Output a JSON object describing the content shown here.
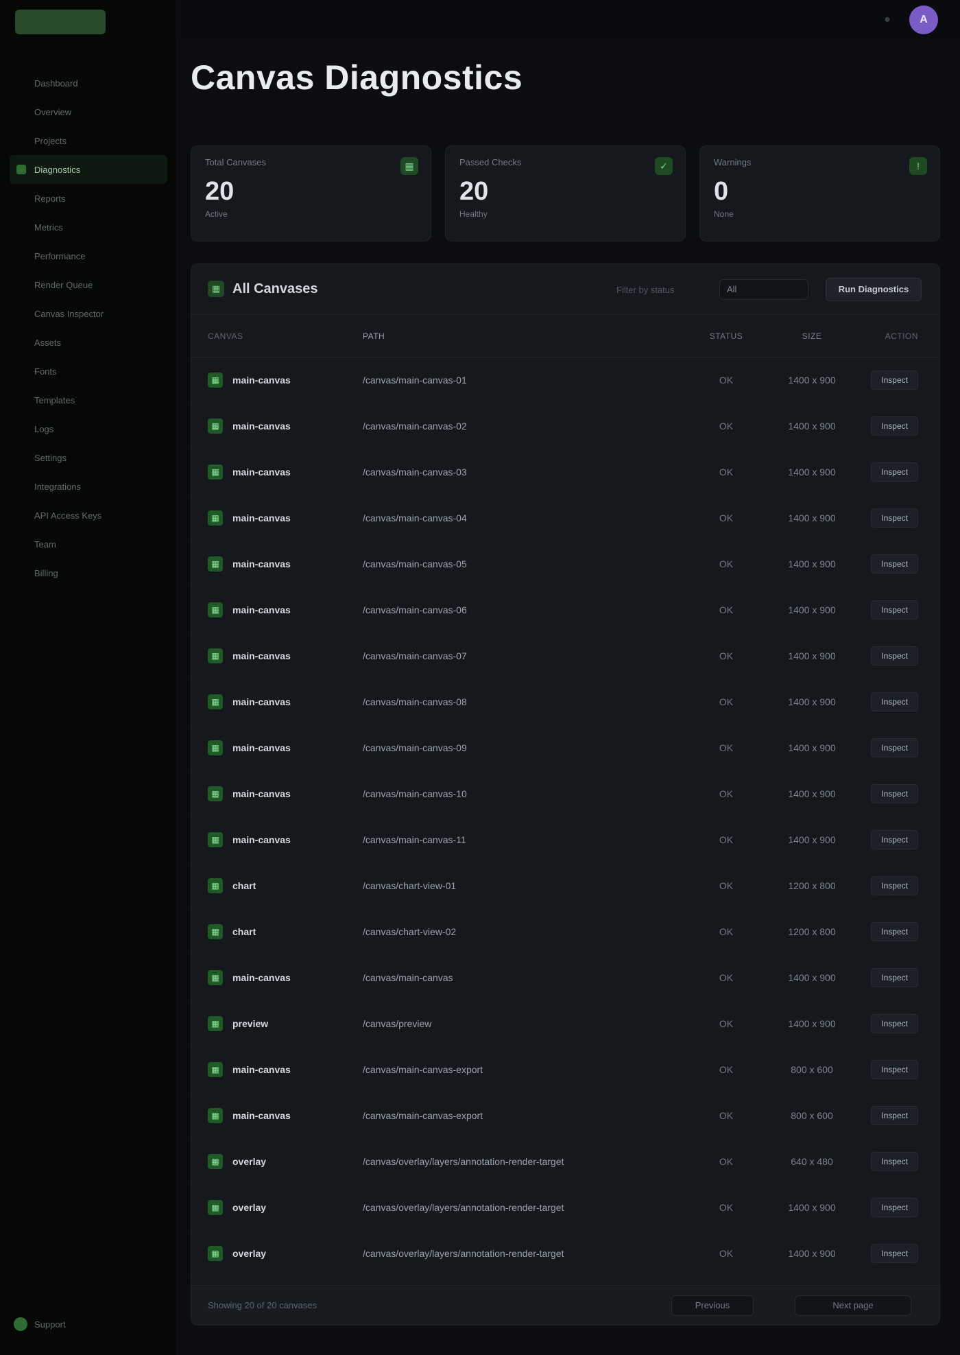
{
  "app": {
    "logo_icon": "app-logo",
    "top_icon": "bell-icon",
    "avatar_initial": "A",
    "avatar_color": "#7b5cc7",
    "accent_color": "#2f6b35"
  },
  "page": {
    "title": "Canvas Diagnostics"
  },
  "sidebar": {
    "items": [
      {
        "label": "Dashboard",
        "active": false
      },
      {
        "label": "Overview",
        "active": false
      },
      {
        "label": "Projects",
        "active": false
      },
      {
        "label": "Diagnostics",
        "active": true
      },
      {
        "label": "Reports",
        "active": false
      },
      {
        "label": "Metrics",
        "active": false
      },
      {
        "label": "Performance",
        "active": false
      },
      {
        "label": "Render Queue",
        "active": false
      },
      {
        "label": "Canvas Inspector",
        "active": false
      },
      {
        "label": "Assets",
        "active": false
      },
      {
        "label": "Fonts",
        "active": false
      },
      {
        "label": "Templates",
        "active": false
      },
      {
        "label": "Logs",
        "active": false
      },
      {
        "label": "Settings",
        "active": false
      },
      {
        "label": "Integrations",
        "active": false
      },
      {
        "label": "API Access Keys",
        "active": false
      },
      {
        "label": "Team",
        "active": false
      },
      {
        "label": "Billing",
        "active": false
      }
    ],
    "footer_label": "Support"
  },
  "stats": [
    {
      "label": "Total Canvases",
      "value": "20",
      "sub": "Active",
      "icon": "grid-icon"
    },
    {
      "label": "Passed Checks",
      "value": "20",
      "sub": "Healthy",
      "icon": "check-icon"
    },
    {
      "label": "Warnings",
      "value": "0",
      "sub": "None",
      "icon": "alert-icon"
    }
  ],
  "table": {
    "title": "All Canvases",
    "title_icon": "grid-icon",
    "filter_label": "Filter by status",
    "filter_value": "All",
    "action_label": "Run Diagnostics",
    "columns": [
      "Canvas",
      "Path",
      "Status",
      "Size",
      "Action"
    ],
    "rows": [
      {
        "name": "main-canvas",
        "path": "/canvas/main-canvas-01",
        "status": "OK",
        "size": "1400 x 900",
        "action": "Inspect"
      },
      {
        "name": "main-canvas",
        "path": "/canvas/main-canvas-02",
        "status": "OK",
        "size": "1400 x 900",
        "action": "Inspect"
      },
      {
        "name": "main-canvas",
        "path": "/canvas/main-canvas-03",
        "status": "OK",
        "size": "1400 x 900",
        "action": "Inspect"
      },
      {
        "name": "main-canvas",
        "path": "/canvas/main-canvas-04",
        "status": "OK",
        "size": "1400 x 900",
        "action": "Inspect"
      },
      {
        "name": "main-canvas",
        "path": "/canvas/main-canvas-05",
        "status": "OK",
        "size": "1400 x 900",
        "action": "Inspect"
      },
      {
        "name": "main-canvas",
        "path": "/canvas/main-canvas-06",
        "status": "OK",
        "size": "1400 x 900",
        "action": "Inspect"
      },
      {
        "name": "main-canvas",
        "path": "/canvas/main-canvas-07",
        "status": "OK",
        "size": "1400 x 900",
        "action": "Inspect"
      },
      {
        "name": "main-canvas",
        "path": "/canvas/main-canvas-08",
        "status": "OK",
        "size": "1400 x 900",
        "action": "Inspect"
      },
      {
        "name": "main-canvas",
        "path": "/canvas/main-canvas-09",
        "status": "OK",
        "size": "1400 x 900",
        "action": "Inspect"
      },
      {
        "name": "main-canvas",
        "path": "/canvas/main-canvas-10",
        "status": "OK",
        "size": "1400 x 900",
        "action": "Inspect"
      },
      {
        "name": "main-canvas",
        "path": "/canvas/main-canvas-11",
        "status": "OK",
        "size": "1400 x 900",
        "action": "Inspect"
      },
      {
        "name": "chart",
        "path": "/canvas/chart-view-01",
        "status": "OK",
        "size": "1200 x 800",
        "action": "Inspect"
      },
      {
        "name": "chart",
        "path": "/canvas/chart-view-02",
        "status": "OK",
        "size": "1200 x 800",
        "action": "Inspect"
      },
      {
        "name": "main-canvas",
        "path": "/canvas/main-canvas",
        "status": "OK",
        "size": "1400 x 900",
        "action": "Inspect"
      },
      {
        "name": "preview",
        "path": "/canvas/preview",
        "status": "OK",
        "size": "1400 x 900",
        "action": "Inspect"
      },
      {
        "name": "main-canvas",
        "path": "/canvas/main-canvas-export",
        "status": "OK",
        "size": "800 x 600",
        "action": "Inspect"
      },
      {
        "name": "main-canvas",
        "path": "/canvas/main-canvas-export",
        "status": "OK",
        "size": "800 x 600",
        "action": "Inspect"
      },
      {
        "name": "overlay",
        "path": "/canvas/overlay/layers/annotation-render-target",
        "status": "OK",
        "size": "640 x 480",
        "action": "Inspect"
      },
      {
        "name": "overlay",
        "path": "/canvas/overlay/layers/annotation-render-target",
        "status": "OK",
        "size": "1400 x 900",
        "action": "Inspect"
      },
      {
        "name": "overlay",
        "path": "/canvas/overlay/layers/annotation-render-target",
        "status": "OK",
        "size": "1400 x 900",
        "action": "Inspect"
      }
    ],
    "footer_text": "Showing 20 of 20 canvases",
    "prev_label": "Previous",
    "next_label": "Next page"
  }
}
